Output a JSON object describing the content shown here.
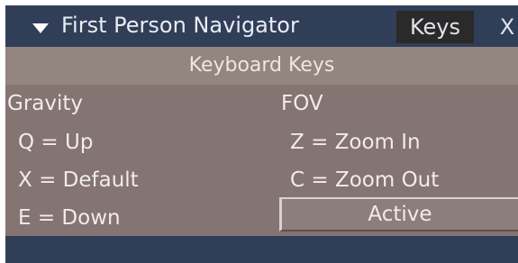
{
  "window": {
    "title": "First Person Navigator",
    "tab_label": "Keys",
    "close_label": "X"
  },
  "section": {
    "header": "Keyboard Keys"
  },
  "gravity": {
    "heading": "Gravity",
    "items": [
      "Q = Up",
      "X = Default",
      "E = Down"
    ]
  },
  "fov": {
    "heading": "FOV",
    "items": [
      "Z = Zoom In",
      "C = Zoom Out"
    ]
  },
  "status_button": {
    "label": "Active"
  },
  "colors": {
    "titlebar": "#303e58",
    "panel": "#847472",
    "header_strip": "#938580"
  }
}
